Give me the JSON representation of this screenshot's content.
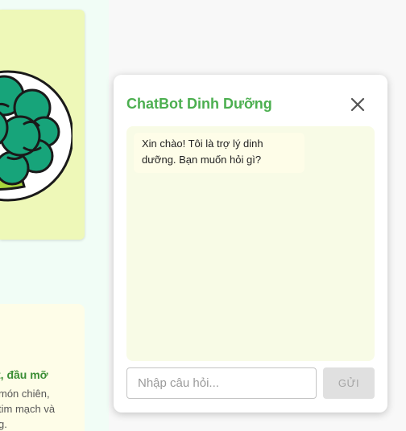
{
  "background_cards": {
    "bottom_card": {
      "title": "t, đầu mỡ",
      "lines": [
        "món chiên,",
        "tim mạch và",
        "g."
      ]
    }
  },
  "chat": {
    "title": "ChatBot Dinh Dưỡng",
    "close_icon": "close-icon",
    "messages": [
      {
        "sender": "bot",
        "text": "Xin chào! Tôi là trợ lý dinh dưỡng. Bạn muốn hỏi gì?"
      }
    ],
    "input": {
      "placeholder": "Nhập câu hỏi...",
      "value": ""
    },
    "send_label": "GỬI"
  },
  "colors": {
    "accent_green": "#4caf50",
    "chat_area_bg": "#f8fbe6",
    "bot_bubble_bg": "#fefde8",
    "card_top_bg": "#eef8b8"
  }
}
